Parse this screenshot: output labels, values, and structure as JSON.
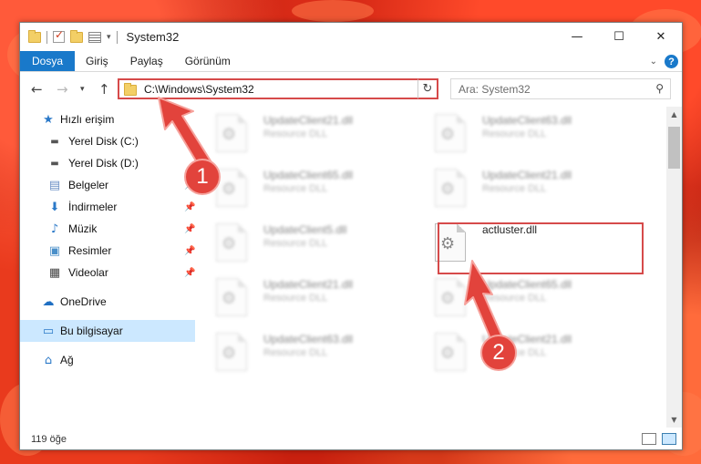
{
  "window": {
    "title": "System32",
    "controls": {
      "minimize": "—",
      "maximize": "☐",
      "close": "✕"
    }
  },
  "ribbon": {
    "tabs": [
      "Dosya",
      "Giriş",
      "Paylaş",
      "Görünüm"
    ],
    "active_tab": "Dosya",
    "help": "?"
  },
  "address": {
    "path": "C:\\Windows\\System32",
    "search_placeholder": "Ara: System32"
  },
  "nav": {
    "items": [
      {
        "label": "Hızlı erişim",
        "icon": "star-icon",
        "pinned": false
      },
      {
        "label": "Yerel Disk (C:)",
        "icon": "drive-icon",
        "pinned": false
      },
      {
        "label": "Yerel Disk (D:)",
        "icon": "drive-icon",
        "pinned": false
      },
      {
        "label": "Belgeler",
        "icon": "documents-icon",
        "pinned": true
      },
      {
        "label": "İndirmeler",
        "icon": "download-icon",
        "pinned": true
      },
      {
        "label": "Müzik",
        "icon": "music-icon",
        "pinned": true
      },
      {
        "label": "Resimler",
        "icon": "pictures-icon",
        "pinned": true
      },
      {
        "label": "Videolar",
        "icon": "videos-icon",
        "pinned": true
      },
      {
        "label": "OneDrive",
        "icon": "cloud-icon",
        "pinned": false
      },
      {
        "label": "Bu bilgisayar",
        "icon": "computer-icon",
        "pinned": false,
        "selected": true
      },
      {
        "label": "Ağ",
        "icon": "network-icon",
        "pinned": false
      }
    ]
  },
  "files": [
    {
      "name": "UpdateClient21.dll",
      "type": "Resource DLL",
      "blurred": true
    },
    {
      "name": "UpdateClient63.dll",
      "type": "Resource DLL",
      "blurred": true
    },
    {
      "name": "UpdateClient65.dll",
      "type": "Resource DLL",
      "blurred": true
    },
    {
      "name": "UpdateClient21.dll",
      "type": "Resource DLL",
      "blurred": true
    },
    {
      "name": "UpdateClient5.dll",
      "type": "Resource DLL",
      "blurred": true
    },
    {
      "name": "actluster.dll",
      "type": "",
      "blurred": false
    },
    {
      "name": "UpdateClient21.dll",
      "type": "Resource DLL",
      "blurred": true
    },
    {
      "name": "UpdateClient65.dll",
      "type": "Resource DLL",
      "blurred": true
    },
    {
      "name": "UpdateClient63.dll",
      "type": "Resource DLL",
      "blurred": true
    },
    {
      "name": "UpdateClient21.dll",
      "type": "Resource DLL",
      "blurred": true
    }
  ],
  "status": {
    "count": "119 öğe"
  },
  "annotations": {
    "step1": "1",
    "step2": "2",
    "color": "#e2433c"
  }
}
